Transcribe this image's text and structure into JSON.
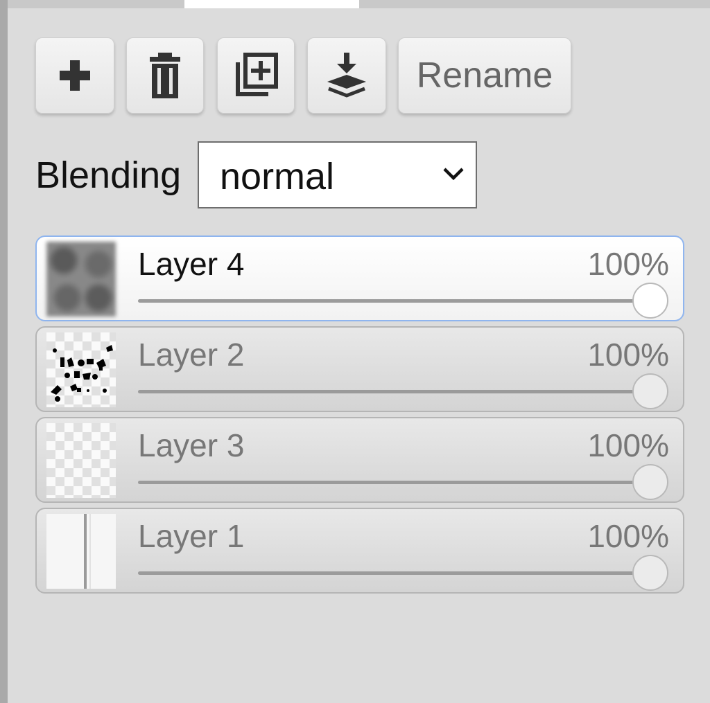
{
  "toolbar": {
    "buttons": [
      {
        "icon": "plus-icon"
      },
      {
        "icon": "trash-icon"
      },
      {
        "icon": "duplicate-icon"
      },
      {
        "icon": "merge-down-icon"
      }
    ],
    "rename_label": "Rename"
  },
  "blending": {
    "label": "Blending",
    "value": "normal"
  },
  "layers": [
    {
      "name": "Layer 4",
      "opacity_label": "100%",
      "opacity": 1.0,
      "selected": true
    },
    {
      "name": "Layer 2",
      "opacity_label": "100%",
      "opacity": 1.0,
      "selected": false
    },
    {
      "name": "Layer 3",
      "opacity_label": "100%",
      "opacity": 1.0,
      "selected": false
    },
    {
      "name": "Layer 1",
      "opacity_label": "100%",
      "opacity": 1.0,
      "selected": false
    }
  ],
  "colors": {
    "panel_bg": "#dcdcdc",
    "selected_border": "#8fb5ef"
  }
}
